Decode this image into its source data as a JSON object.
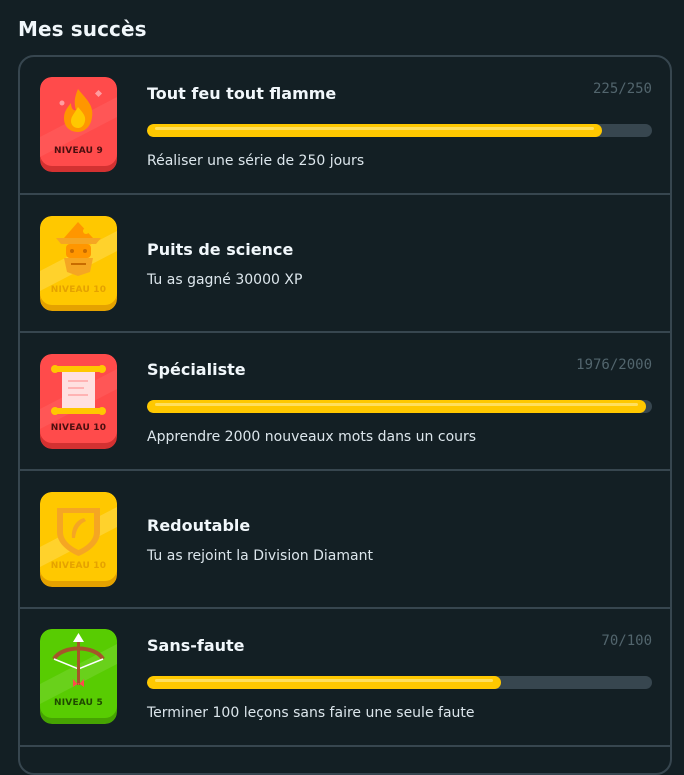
{
  "section": {
    "title": "Mes succès"
  },
  "achievements": [
    {
      "title": "Tout feu tout flamme",
      "description": "Réaliser une série de 250 jours",
      "level": "NIVEAU 9",
      "progress_text": "225/250",
      "progress": 0.9,
      "badge_color": "#ff4b4b",
      "icon": "flame-icon"
    },
    {
      "title": "Puits de science",
      "description": "Tu as gagné 30000 XP",
      "level": "NIVEAU 10",
      "badge_color": "#ffc800",
      "icon": "wizard-icon"
    },
    {
      "title": "Spécialiste",
      "description": "Apprendre 2000 nouveaux mots dans un cours",
      "level": "NIVEAU 10",
      "progress_text": "1976/2000",
      "progress": 0.988,
      "badge_color": "#ff4b4b",
      "icon": "scroll-icon"
    },
    {
      "title": "Redoutable",
      "description": "Tu as rejoint la Division Diamant",
      "level": "NIVEAU 10",
      "badge_color": "#ffc800",
      "icon": "shield-feather-icon"
    },
    {
      "title": "Sans-faute",
      "description": "Terminer 100 leçons sans faire une seule faute",
      "level": "NIVEAU 5",
      "progress_text": "70/100",
      "progress": 0.7,
      "badge_color": "#58cc02",
      "icon": "bow-arrow-icon"
    }
  ],
  "colors": {
    "background": "#131f24",
    "border": "#37464f",
    "progress_fill": "#ffc800",
    "progress_track": "#37464f"
  }
}
